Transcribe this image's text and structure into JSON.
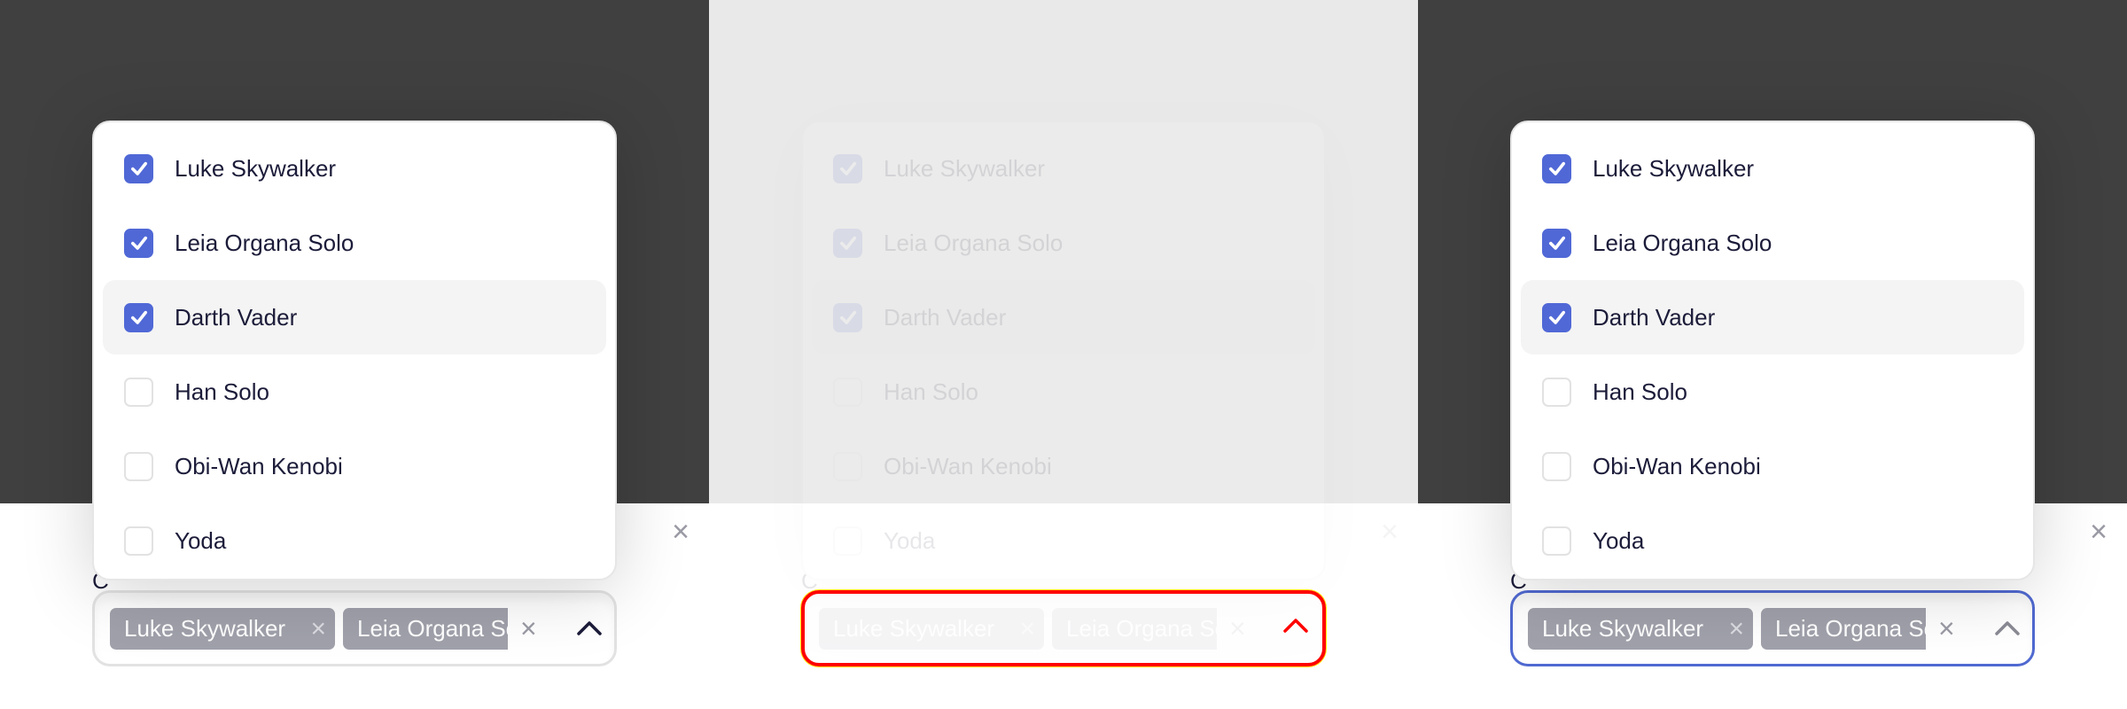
{
  "panels": [
    {
      "state": "default",
      "chevron_color": "#1c1c3a"
    },
    {
      "state": "disabled",
      "chevron_color": "#ff0000"
    },
    {
      "state": "focus",
      "chevron_color": "#8a8a95"
    }
  ],
  "label_fragment": "C",
  "options": [
    {
      "label": "Luke Skywalker",
      "checked": true
    },
    {
      "label": "Leia Organa Solo",
      "checked": true
    },
    {
      "label": "Darth Vader",
      "checked": true,
      "highlighted": true
    },
    {
      "label": "Han Solo",
      "checked": false
    },
    {
      "label": "Obi-Wan Kenobi",
      "checked": false
    },
    {
      "label": "Yoda",
      "checked": false
    }
  ],
  "chips": [
    "Luke Skywalker",
    "Leia Organa Solo"
  ],
  "icons": {
    "clear": "×",
    "chip_remove": "×",
    "chevron": "chevron-up-icon",
    "check": "check-icon"
  },
  "colors": {
    "accent": "#5068d6",
    "focus_border": "#5069d0",
    "error_border": "#ff0000",
    "chip_bg": "#a0a1ab",
    "dark_bg": "#404040"
  }
}
